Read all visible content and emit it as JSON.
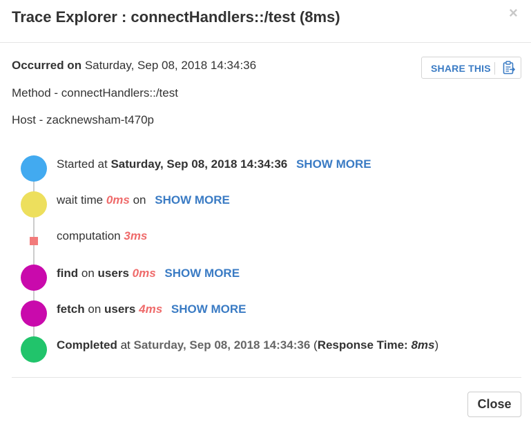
{
  "modal": {
    "title": "Trace Explorer : connectHandlers::/test (8ms)",
    "close_glyph": "×"
  },
  "info": {
    "occurred_label": "Occurred on",
    "occurred_value": "Saturday, Sep 08, 2018 14:34:36",
    "method": "Method - connectHandlers::/test",
    "host": "Host - zacknewsham-t470p"
  },
  "share": {
    "label": "SHARE THIS",
    "icon": "clipboard-icon"
  },
  "colors": {
    "started": "#42aaf0",
    "wait": "#eddf5d",
    "computation": "#f27b7b",
    "db": "#c90aac",
    "completed": "#21c46b",
    "duration_text": "#ef6b6b",
    "link": "#3a7bc4"
  },
  "events": {
    "started": {
      "prefix": "Started at",
      "date": "Saturday, Sep 08, 2018 14:34:36",
      "show_more": "SHOW MORE"
    },
    "wait": {
      "prefix": "wait time",
      "duration": "0ms",
      "suffix": "on",
      "show_more": "SHOW MORE"
    },
    "computation": {
      "prefix": "computation",
      "duration": "3ms"
    },
    "find": {
      "op": "find",
      "on": "on",
      "collection": "users",
      "duration": "0ms",
      "show_more": "SHOW MORE"
    },
    "fetch": {
      "op": "fetch",
      "on": "on",
      "collection": "users",
      "duration": "4ms",
      "show_more": "SHOW MORE"
    },
    "completed": {
      "label": "Completed",
      "at": "at",
      "date": "Saturday, Sep 08, 2018 14:34:36",
      "open_paren": "(",
      "response_label": "Response Time:",
      "response_value": "8ms",
      "close_paren": ")"
    }
  },
  "footer": {
    "close_label": "Close"
  }
}
